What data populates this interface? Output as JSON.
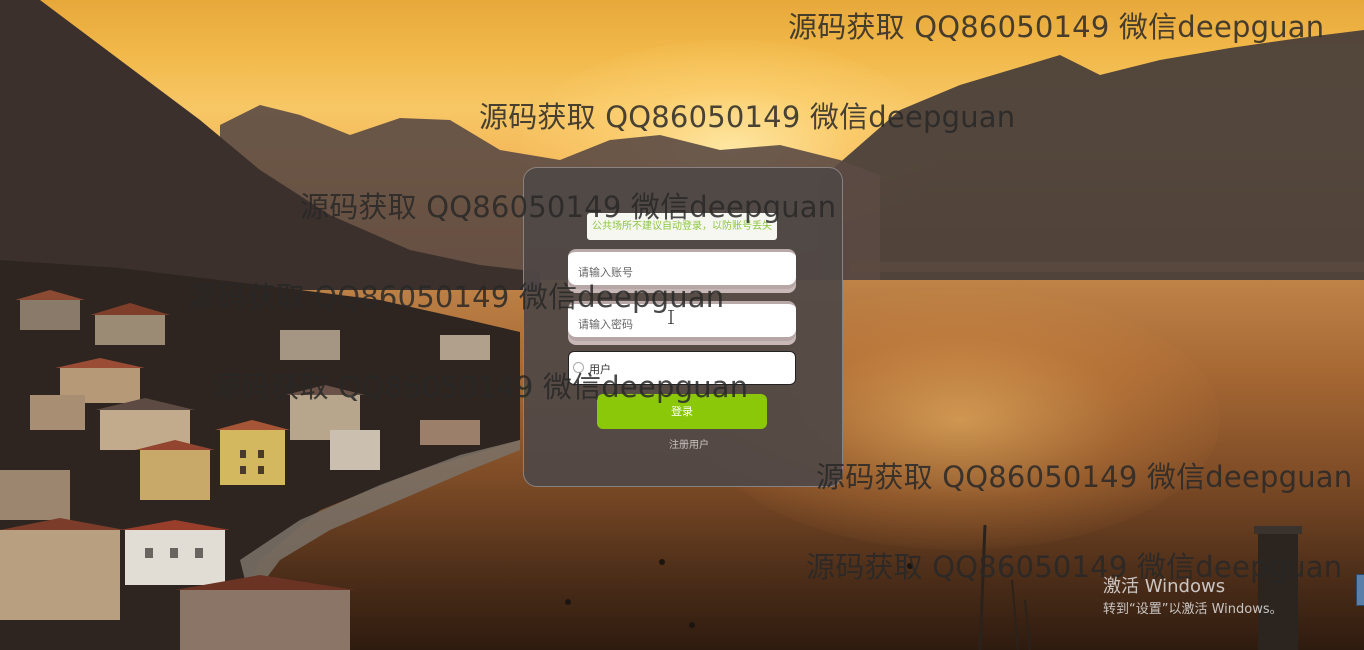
{
  "login": {
    "notice": "公共场所不建议自动登录，以防账号丢失",
    "account_placeholder": "请输入账号",
    "password_placeholder": "请输入密码",
    "role_label": "用户",
    "login_button": "登录",
    "register_link": "注册用户"
  },
  "watermarks": [
    "源码获取 QQ86050149 微信deepguan",
    "源码获取 QQ86050149 微信deepguan",
    "源码获取 QQ86050149 微信deepguan",
    "源码获取 QQ86050149 微信deepguan",
    "源码获取 QQ86050149 微信deepguan",
    "源码获取 QQ86050149 微信deepguan",
    "源码获取 QQ86050149 微信deepguan"
  ],
  "windows_activation": {
    "title": "激活 Windows",
    "subtitle": "转到“设置”以激活 Windows。"
  },
  "colors": {
    "accent_green": "#8cc80a",
    "notice_green": "#8cc63f",
    "panel_bg": "#504846"
  },
  "icons": {
    "cursor": "text-cursor-icon"
  }
}
